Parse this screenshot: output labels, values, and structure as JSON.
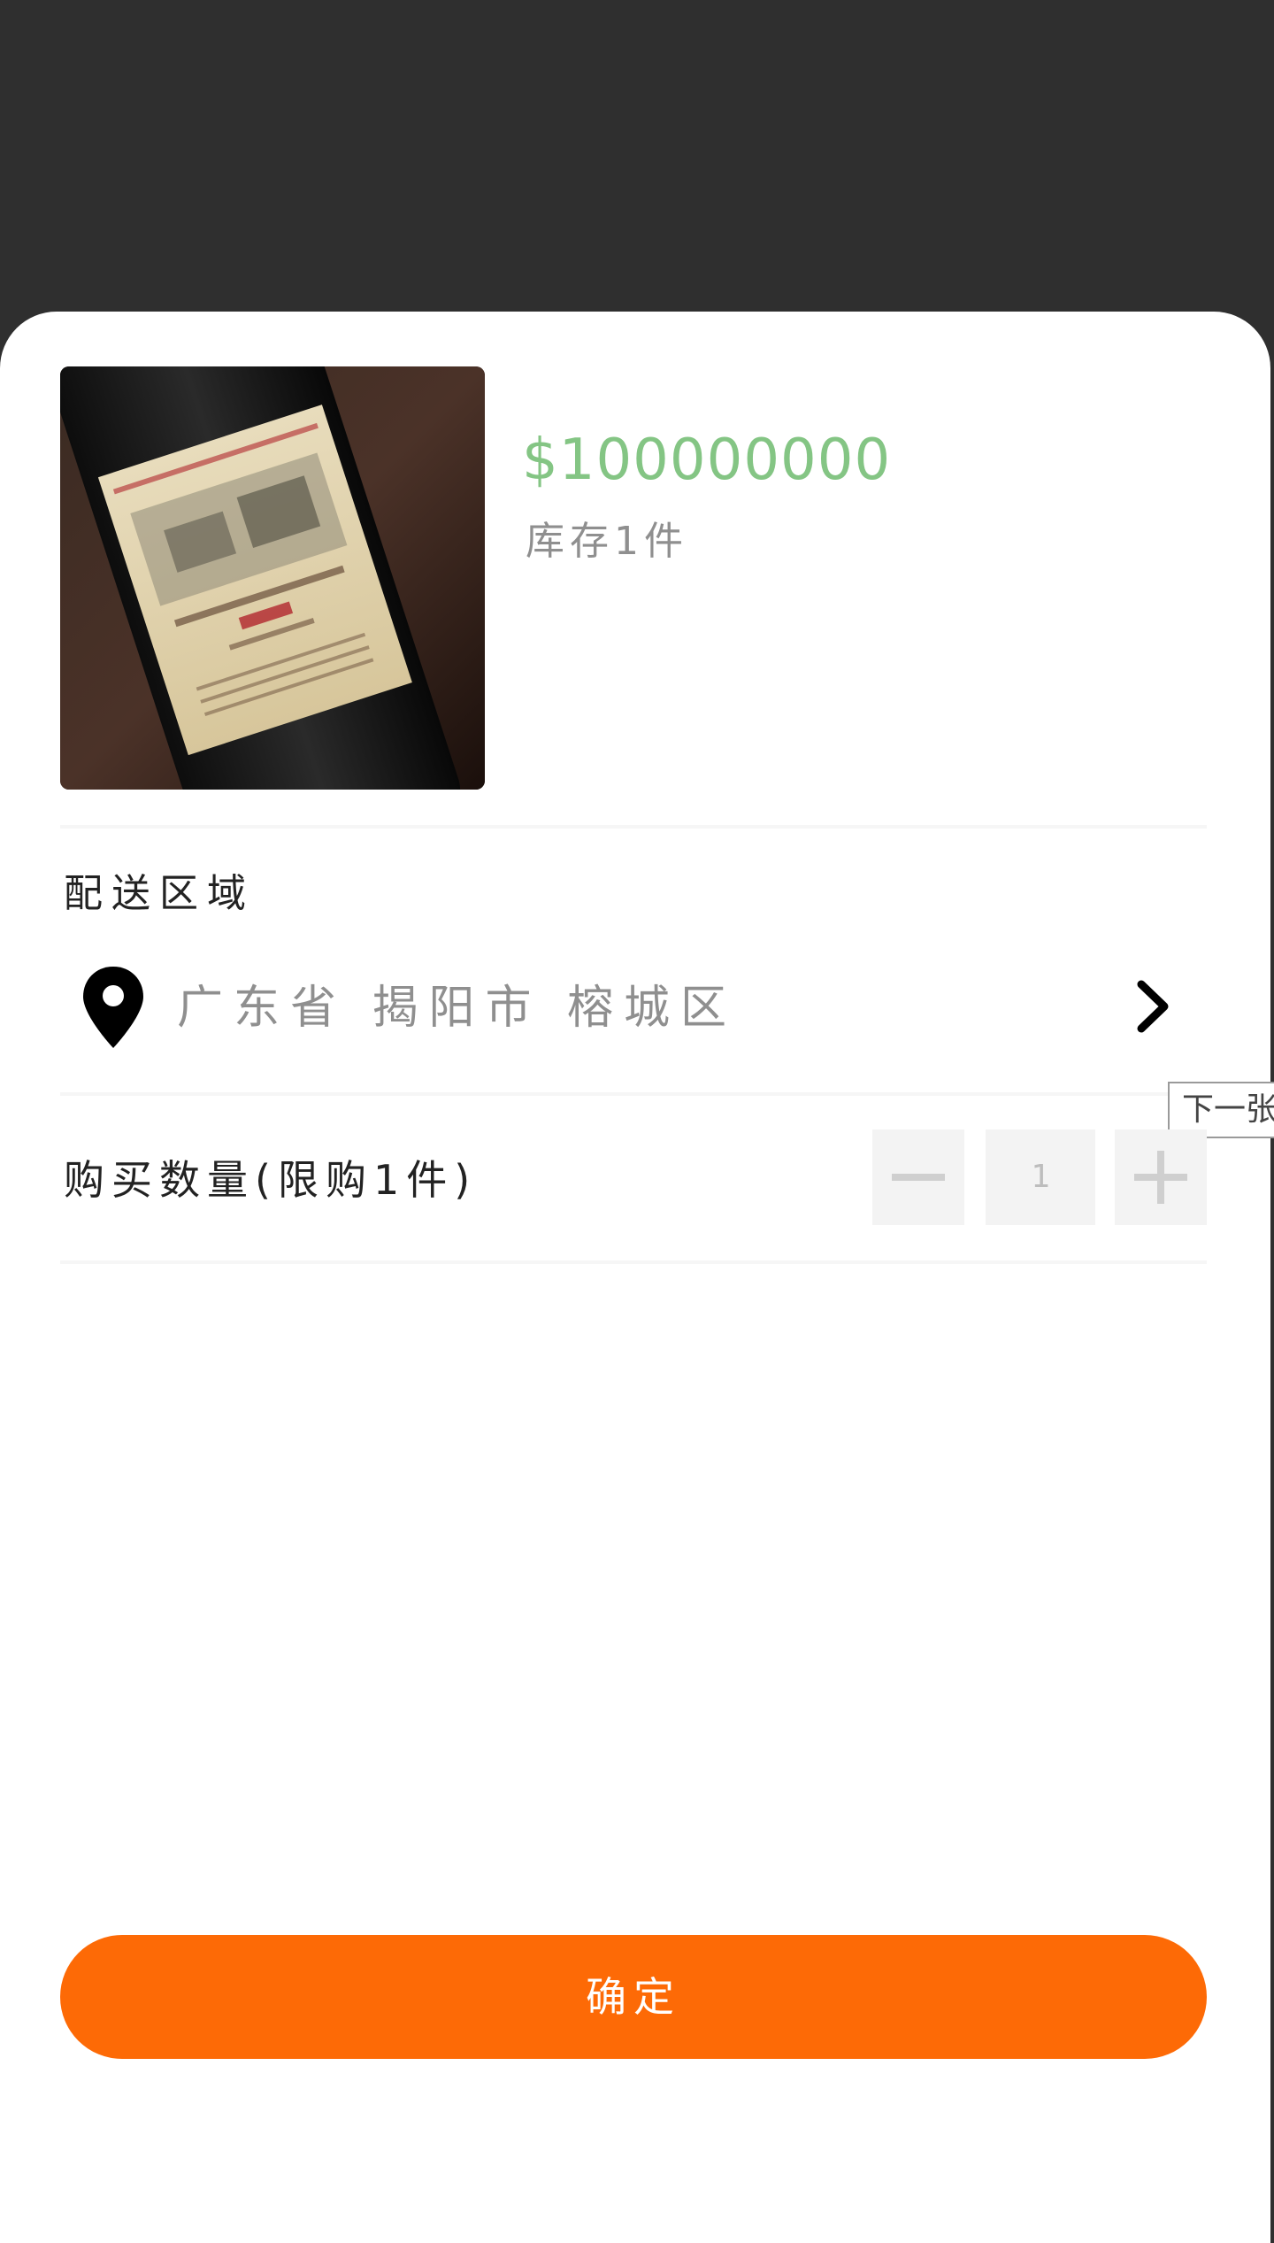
{
  "product": {
    "price": "$100000000",
    "stock": "库存1件",
    "image_icon": "wine-bottle-photo"
  },
  "delivery": {
    "section_label": "配送区域",
    "address": "广东省 揭阳市 榕城区",
    "pin_icon": "location-pin-icon",
    "chevron_icon": "chevron-right-icon"
  },
  "tooltip": {
    "text": "下一张"
  },
  "quantity": {
    "label": "购买数量(限购1件)",
    "value": "1",
    "minus_icon": "minus-icon",
    "plus_icon": "plus-icon"
  },
  "actions": {
    "confirm_label": "确定"
  },
  "colors": {
    "price": "#84c584",
    "confirm": "#fd6a06",
    "overlay": "#2f2f2f"
  }
}
